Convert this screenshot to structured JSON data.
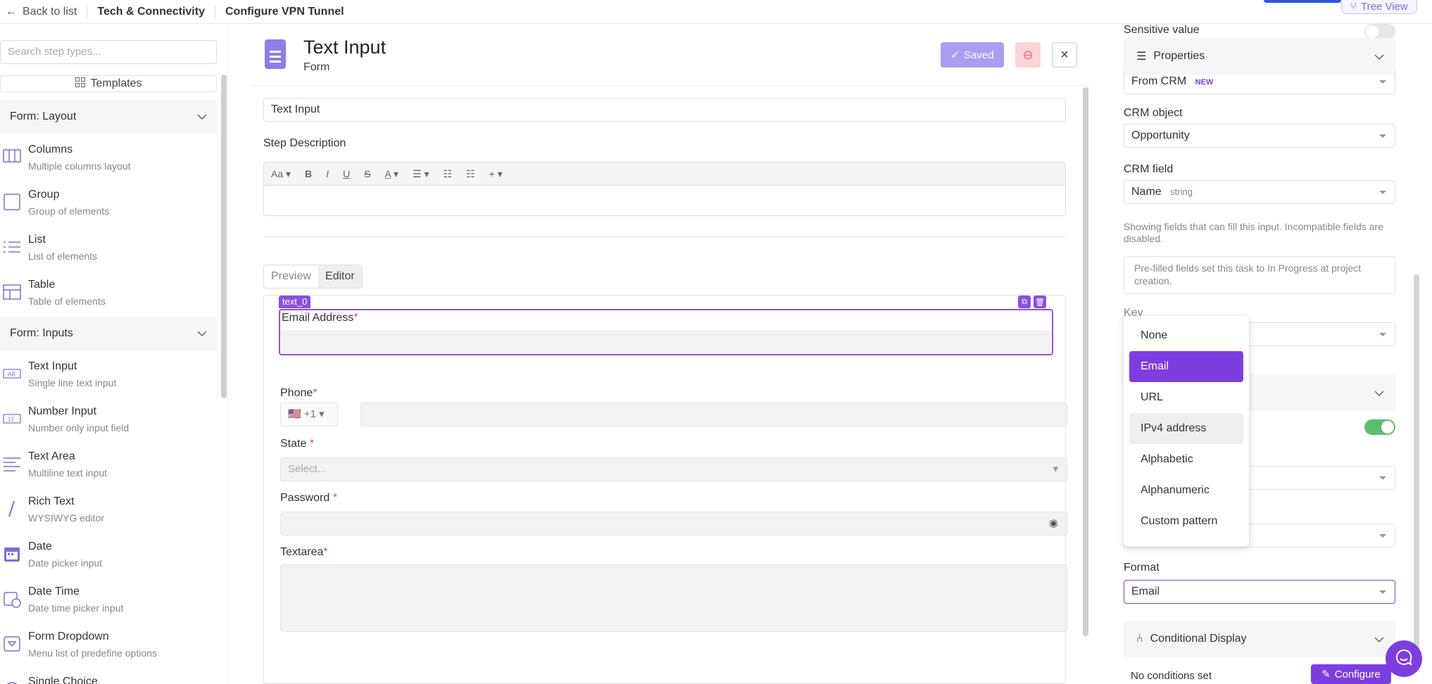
{
  "topbar": {
    "back_label": "Back to list",
    "crumb1": "Tech & Connectivity",
    "crumb2": "Configure VPN Tunnel",
    "tree_view": "Tree View"
  },
  "sidebar": {
    "search_placeholder": "Search step types...",
    "templates_label": "Templates",
    "groups": [
      {
        "label": "Form: Layout"
      },
      {
        "label": "Form: Inputs"
      }
    ],
    "layout_items": [
      {
        "title": "Columns",
        "sub": "Multiple columns layout",
        "icon": "columns-icon"
      },
      {
        "title": "Group",
        "sub": "Group of elements",
        "icon": "group-icon"
      },
      {
        "title": "List",
        "sub": "List of elements",
        "icon": "list-icon"
      },
      {
        "title": "Table",
        "sub": "Table of elements",
        "icon": "table-icon"
      }
    ],
    "input_items": [
      {
        "title": "Text Input",
        "sub": "Single line text input",
        "icon": "text-input-icon",
        "glyph": "AB"
      },
      {
        "title": "Number Input",
        "sub": "Number only input field",
        "icon": "number-input-icon",
        "glyph": "12"
      },
      {
        "title": "Text Area",
        "sub": "Multiline text input",
        "icon": "text-area-icon"
      },
      {
        "title": "Rich Text",
        "sub": "WYSIWYG editor",
        "icon": "rich-text-icon"
      },
      {
        "title": "Date",
        "sub": "Date picker input",
        "icon": "calendar-icon"
      },
      {
        "title": "Date Time",
        "sub": "Date time picker input",
        "icon": "calendar-clock-icon"
      },
      {
        "title": "Form Dropdown",
        "sub": "Menu list of predefine options",
        "icon": "dropdown-icon"
      },
      {
        "title": "Single Choice",
        "sub": "",
        "icon": "radio-icon"
      }
    ]
  },
  "editor": {
    "title": "Text Input",
    "subtitle": "Form",
    "saved_label": "Saved",
    "step_name_value": "Text Input",
    "step_description_label": "Step Description",
    "toolbar": {
      "font": "Aa",
      "bold": "B",
      "italic": "I",
      "underline": "U",
      "strike": "S",
      "color": "A",
      "plus": "+"
    },
    "tabs": [
      "Preview",
      "Editor"
    ],
    "selected_tag": "text_0",
    "fields": {
      "email_label": "Email Address",
      "phone_label": "Phone",
      "phone_prefix": "+1",
      "state_label": "State",
      "state_placeholder": "Select...",
      "password_label": "Password",
      "textarea_label": "Textarea",
      "required_mark": "*"
    }
  },
  "props": {
    "sensitive_label": "Sensitive value",
    "properties_header": "Properties",
    "source_value": "From CRM",
    "source_badge": "NEW",
    "crm_object_label": "CRM object",
    "crm_object_value": "Opportunity",
    "crm_field_label": "CRM field",
    "crm_field_value": "Name",
    "crm_field_type": "string",
    "crm_field_note": "Showing fields that can fill this input. Incompatible fields are disabled.",
    "prefill_note": "Pre-filled fields set this task to In Progress at project creation.",
    "key_label": "Key",
    "format_label": "Format",
    "format_value": "Email",
    "conditional_header": "Conditional Display",
    "no_conditions": "No conditions set",
    "configure_label": "Configure",
    "accent_color": "#7d3ee0",
    "toggle_on_color": "#5cbf6e"
  },
  "format_menu": {
    "options": [
      "None",
      "Email",
      "URL",
      "IPv4 address",
      "Alphabetic",
      "Alphanumeric",
      "Custom pattern"
    ],
    "selected": "Email",
    "hovered": "IPv4 address"
  }
}
